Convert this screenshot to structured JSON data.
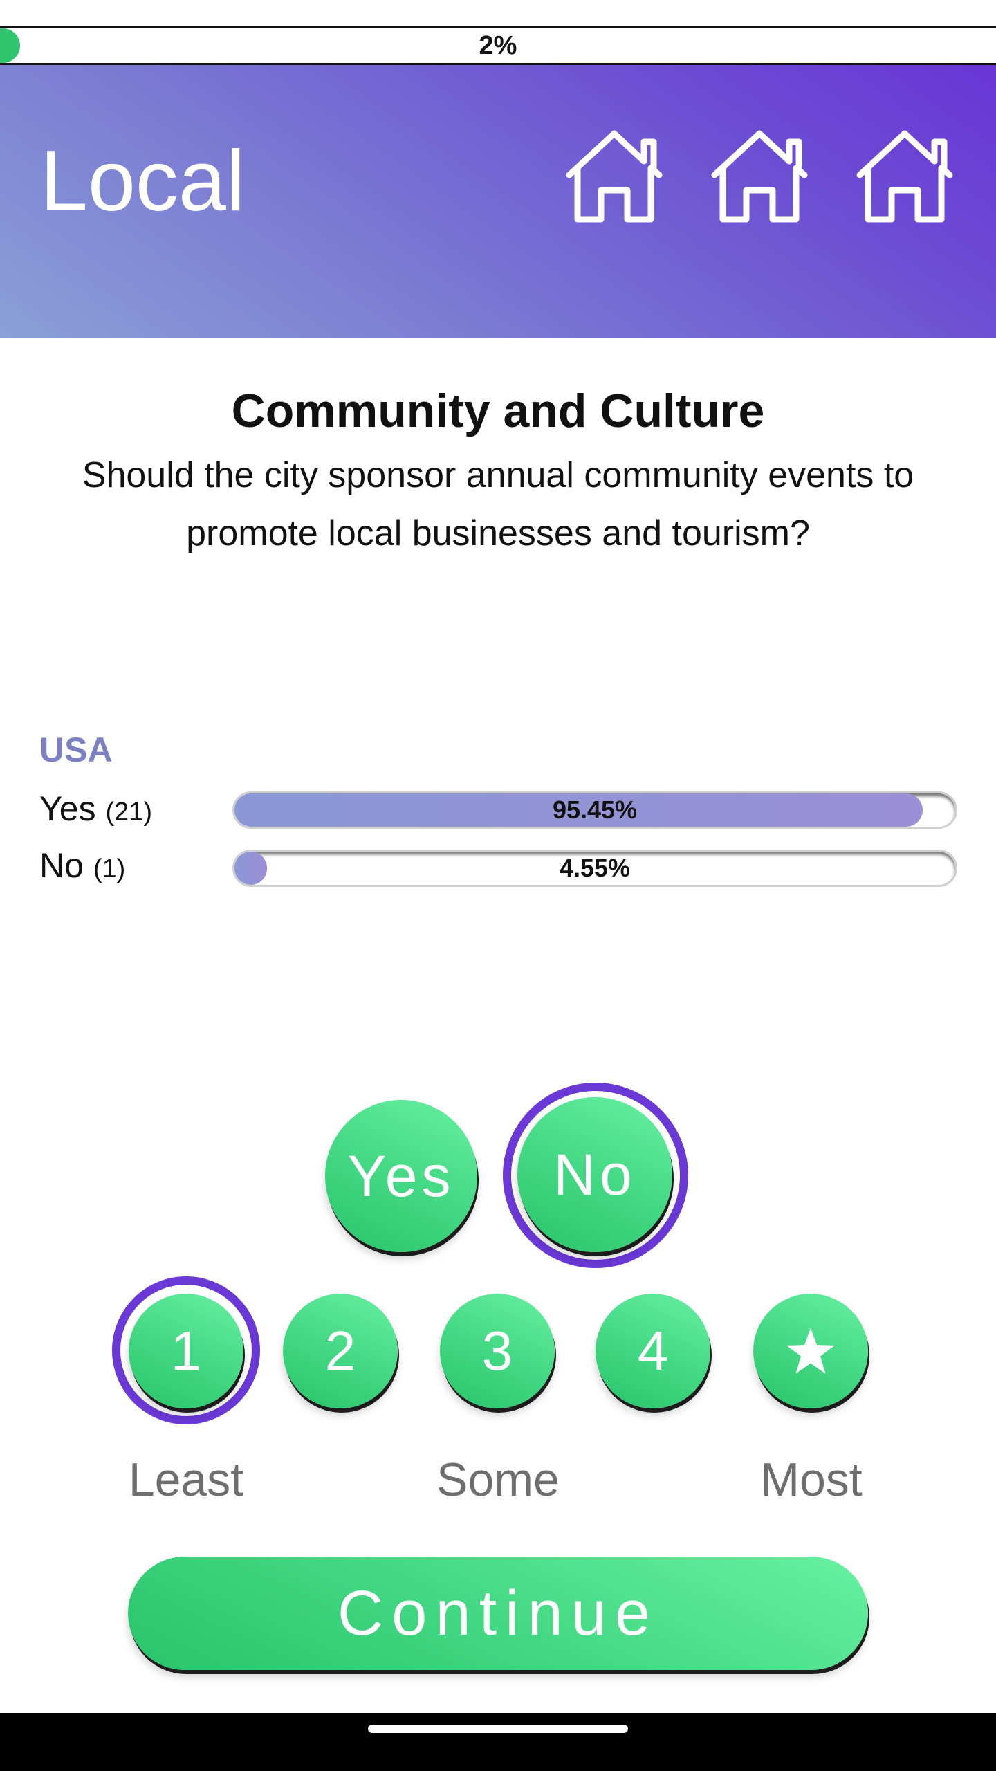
{
  "progress": {
    "label": "2%",
    "fraction": 0.02
  },
  "header": {
    "title": "Local",
    "icons": [
      "house-icon",
      "house-icon",
      "house-icon"
    ]
  },
  "question": {
    "category": "Community and Culture",
    "text": "Should the city sponsor annual community events to promote local businesses and tourism?"
  },
  "results": {
    "region": "USA",
    "rows": [
      {
        "label": "Yes",
        "count": "(21)",
        "percent_label": "95.45%",
        "fraction": 0.9545
      },
      {
        "label": "No",
        "count": "(1)",
        "percent_label": "4.55%",
        "fraction": 0.0455
      }
    ]
  },
  "answer": {
    "yes_label": "Yes",
    "no_label": "No",
    "selected": "No"
  },
  "rating": {
    "options": [
      "1",
      "2",
      "3",
      "4"
    ],
    "star_icon": "star-icon",
    "selected": "1",
    "scale_labels": {
      "least": "Least",
      "some": "Some",
      "most": "Most"
    }
  },
  "continue_label": "Continue",
  "colors": {
    "accent_purple": "#6a38d5",
    "green": "#2fc46d",
    "result_bar": "#8a98d6"
  }
}
